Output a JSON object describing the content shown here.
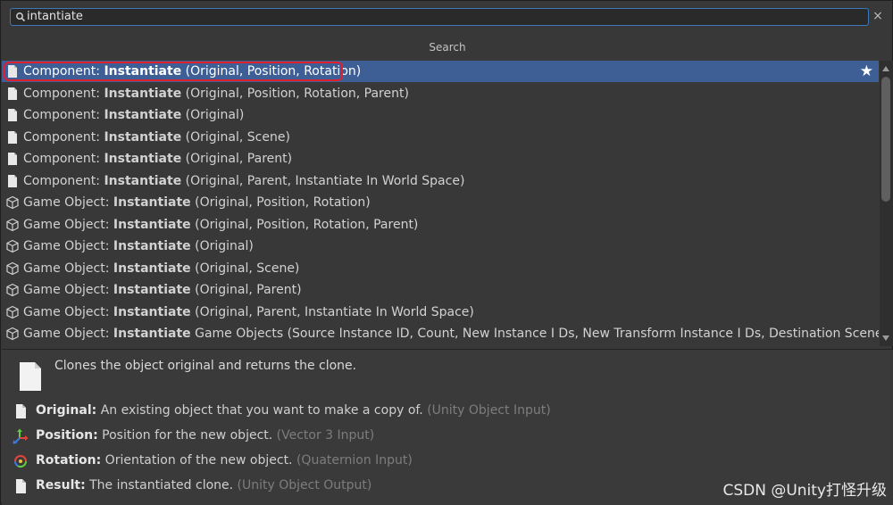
{
  "search": {
    "value": "intantiate",
    "icon": "search-icon",
    "clear_label": "×"
  },
  "section_title": "Search",
  "results": [
    {
      "prefix": "Component: ",
      "method": "Instantiate",
      "args": " (Original, Position, Rotation)",
      "icon": "script-icon",
      "selected": true,
      "favorite": true
    },
    {
      "prefix": "Component: ",
      "method": "Instantiate",
      "args": " (Original, Position, Rotation, Parent)",
      "icon": "script-icon"
    },
    {
      "prefix": "Component: ",
      "method": "Instantiate",
      "args": " (Original)",
      "icon": "script-icon"
    },
    {
      "prefix": "Component: ",
      "method": "Instantiate",
      "args": " (Original, Scene)",
      "icon": "script-icon"
    },
    {
      "prefix": "Component: ",
      "method": "Instantiate",
      "args": " (Original, Parent)",
      "icon": "script-icon"
    },
    {
      "prefix": "Component: ",
      "method": "Instantiate",
      "args": " (Original, Parent, Instantiate In World Space)",
      "icon": "script-icon"
    },
    {
      "prefix": "Game Object: ",
      "method": "Instantiate",
      "args": " (Original, Position, Rotation)",
      "icon": "cube-icon"
    },
    {
      "prefix": "Game Object: ",
      "method": "Instantiate",
      "args": " (Original, Position, Rotation, Parent)",
      "icon": "cube-icon"
    },
    {
      "prefix": "Game Object: ",
      "method": "Instantiate",
      "args": " (Original)",
      "icon": "cube-icon"
    },
    {
      "prefix": "Game Object: ",
      "method": "Instantiate",
      "args": " (Original, Scene)",
      "icon": "cube-icon"
    },
    {
      "prefix": "Game Object: ",
      "method": "Instantiate",
      "args": " (Original, Parent)",
      "icon": "cube-icon"
    },
    {
      "prefix": "Game Object: ",
      "method": "Instantiate",
      "args": " (Original, Parent, Instantiate In World Space)",
      "icon": "cube-icon"
    },
    {
      "prefix": "Game Object: ",
      "method": "Instantiate",
      "args": " Game Objects (Source Instance ID, Count, New Instance I Ds, New Transform Instance I Ds, Destination Scene)",
      "icon": "cube-icon"
    }
  ],
  "details": {
    "description": "Clones the object original and returns the clone.",
    "ports": [
      {
        "name": "Original:",
        "desc": " An existing object that you want to make a copy of. ",
        "type": "(Unity Object Input)",
        "icon": "document-icon"
      },
      {
        "name": "Position:",
        "desc": " Position for the new object. ",
        "type": "(Vector 3 Input)",
        "icon": "move-axes-icon"
      },
      {
        "name": "Rotation:",
        "desc": " Orientation of the new object. ",
        "type": "(Quaternion Input)",
        "icon": "rotate-icon"
      },
      {
        "name": "Result:",
        "desc": " The instantiated clone. ",
        "type": "(Unity Object Output)",
        "icon": "document-icon"
      }
    ]
  },
  "watermark": "CSDN @Unity打怪升级",
  "colors": {
    "selection": "#3e5f96",
    "focus_border": "#3a79bb",
    "annotation_red": "#e0202e"
  }
}
